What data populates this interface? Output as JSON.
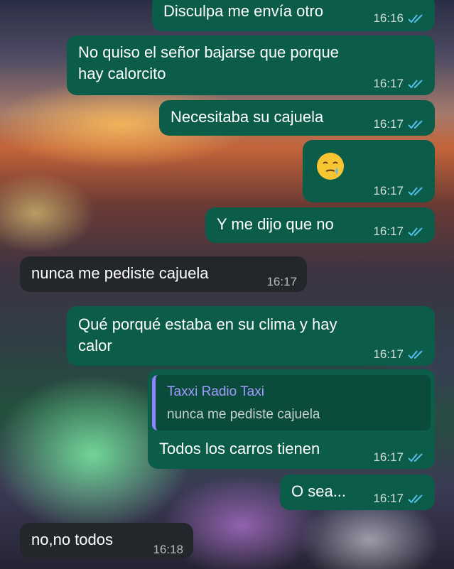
{
  "chat": {
    "messages": [
      {
        "text": "Disculpa me envía otro",
        "time": "16:16"
      },
      {
        "text_line1": "No quiso el señor bajarse que porque",
        "text_line2": "hay calorcito",
        "time": "16:17"
      },
      {
        "text": "Necesitaba su cajuela",
        "time": "16:17"
      },
      {
        "emoji": "crying-face-emoji",
        "time": "16:17"
      },
      {
        "text": "Y me dijo que no",
        "time": "16:17"
      },
      {
        "text": "nunca me pediste cajuela",
        "time": "16:17"
      },
      {
        "text_line1": "Qué porqué estaba en su clima y hay",
        "text_line2": "calor",
        "time": "16:17"
      },
      {
        "quote_author": "Taxxi Radio Taxi",
        "quote_text": "nunca me pediste cajuela",
        "text": "Todos los carros tienen",
        "time": "16:17"
      },
      {
        "text": "O sea...",
        "time": "16:17"
      },
      {
        "text": "no,no todos",
        "time": "16:18"
      }
    ]
  },
  "colors": {
    "outgoing_bubble": "#0b5c49",
    "incoming_bubble": "#23262b",
    "read_ticks": "#53bdeb",
    "quote_author": "#a39cff"
  }
}
